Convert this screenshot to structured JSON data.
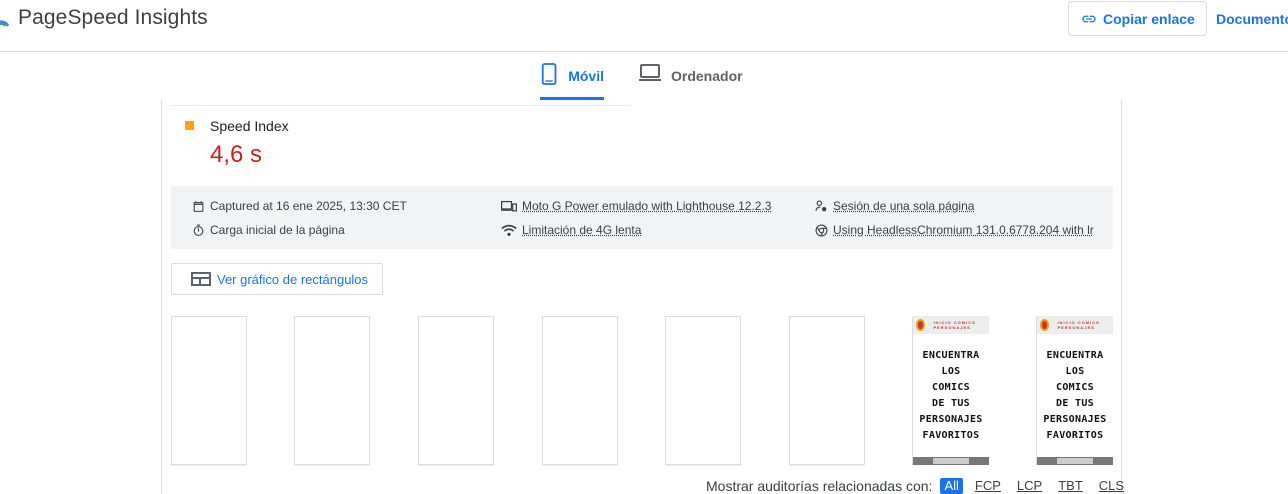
{
  "header": {
    "app_title": "PageSpeed Insights",
    "copy_link_label": "Copiar enlace",
    "docs_label": "Documento"
  },
  "tabs": [
    {
      "label": "Móvil",
      "active": true
    },
    {
      "label": "Ordenador",
      "active": false
    }
  ],
  "metric": {
    "name": "Speed Index",
    "value": "4,6 s",
    "status_color": "#ffa400",
    "value_color": "#c5221f"
  },
  "info": {
    "captured": "Captured at 16 ene 2025, 13:30 CET",
    "load": "Carga inicial de la página",
    "device": "Moto G Power emulado with Lighthouse 12.2.3",
    "network": "Limitación de 4G lenta",
    "session": "Sesión de una sola página",
    "browser": "Using HeadlessChromium 131.0.6778.204 with lr"
  },
  "treemap_label": "Ver gráfico de rectángulos",
  "filmstrip": {
    "blank_frames": 6,
    "content_frame_lines": [
      "ENCUENTRA",
      "LOS",
      "COMICS",
      "DE TUS",
      "PERSONAJES",
      "FAVORITOS"
    ],
    "content_frame_nav": "INICIO COMICS PERSONAJES"
  },
  "audit_filter": {
    "label": "Mostrar auditorías relacionadas con:",
    "options": [
      "All",
      "FCP",
      "LCP",
      "TBT",
      "CLS"
    ],
    "selected": "All"
  },
  "colors": {
    "accent": "#1a73e8",
    "average": "#ffa400",
    "fail": "#c5221f"
  }
}
